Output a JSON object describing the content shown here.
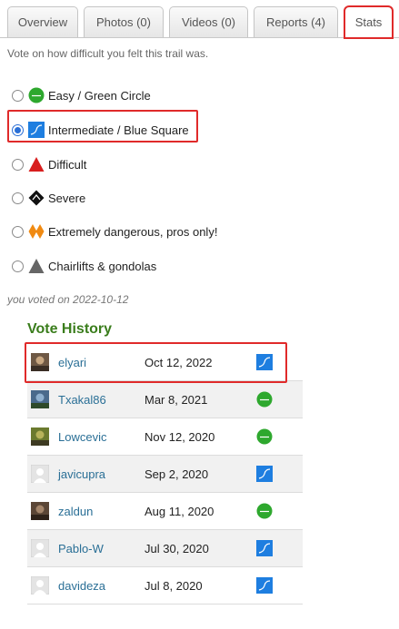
{
  "tabs": [
    {
      "label": "Overview",
      "active": false
    },
    {
      "label": "Photos (0)",
      "active": false
    },
    {
      "label": "Videos (0)",
      "active": false
    },
    {
      "label": "Reports (4)",
      "active": false
    },
    {
      "label": "Stats",
      "active": true
    }
  ],
  "intro": "Vote on how difficult you felt this trail was.",
  "options": [
    {
      "label": "Easy / Green Circle",
      "icon": "green-circle-icon",
      "checked": false
    },
    {
      "label": "Intermediate / Blue Square",
      "icon": "blue-square-icon",
      "checked": true
    },
    {
      "label": "Difficult",
      "icon": "red-triangle-icon",
      "checked": false
    },
    {
      "label": "Severe",
      "icon": "black-diamond-icon",
      "checked": false
    },
    {
      "label": "Extremely dangerous, pros only!",
      "icon": "orange-double-diamond-icon",
      "checked": false
    },
    {
      "label": "Chairlifts & gondolas",
      "icon": "gray-triangle-icon",
      "checked": false
    }
  ],
  "voted_text": "you voted on 2022-10-12",
  "vote_history": {
    "title": "Vote History",
    "rows": [
      {
        "user": "elyari",
        "date": "Oct 12, 2022",
        "icon": "blue-square-icon",
        "avatar": "photo"
      },
      {
        "user": "Txakal86",
        "date": "Mar 8, 2021",
        "icon": "green-circle-icon",
        "avatar": "photo"
      },
      {
        "user": "Lowcevic",
        "date": "Nov 12, 2020",
        "icon": "green-circle-icon",
        "avatar": "photo"
      },
      {
        "user": "javicupra",
        "date": "Sep 2, 2020",
        "icon": "blue-square-icon",
        "avatar": "placeholder"
      },
      {
        "user": "zaldun",
        "date": "Aug 11, 2020",
        "icon": "green-circle-icon",
        "avatar": "photo"
      },
      {
        "user": "Pablo-W",
        "date": "Jul 30, 2020",
        "icon": "blue-square-icon",
        "avatar": "placeholder"
      },
      {
        "user": "davideza",
        "date": "Jul 8, 2020",
        "icon": "blue-square-icon",
        "avatar": "placeholder"
      }
    ]
  },
  "colors": {
    "green": "#2ea82e",
    "blue": "#1e7ee0",
    "red": "#d81e1e",
    "black": "#111111",
    "orange": "#f08a12",
    "gray": "#666666",
    "highlight": "#e02a2a",
    "title_green": "#3a7d1c",
    "link": "#2a6f96"
  }
}
